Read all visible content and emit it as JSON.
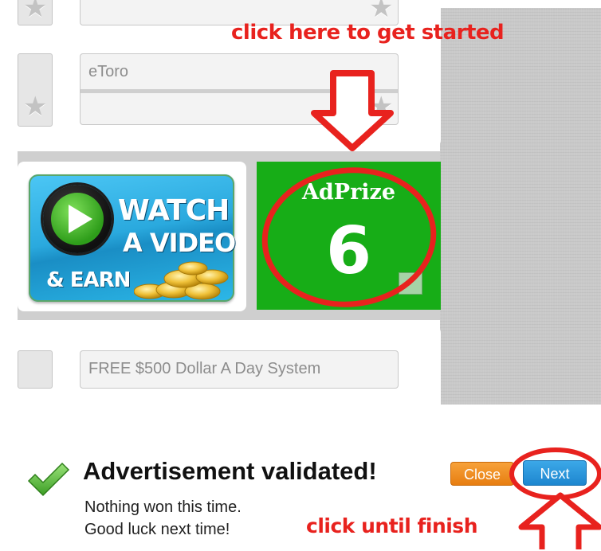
{
  "ad_list": {
    "item_2_label": "eToro",
    "item_3_label": "FREE $500 Dollar A Day System"
  },
  "watch_video_button": {
    "line1": "WATCH",
    "line2": "A VIDEO",
    "line3": "& EARN"
  },
  "adprize": {
    "title": "AdPrize",
    "count": "6"
  },
  "annotations": {
    "top": "click here to get started",
    "bottom": "click until finish"
  },
  "result": {
    "title": "Advertisement validated!",
    "line1": "Nothing won this time.",
    "line2": "Good luck next time!",
    "close_label": "Close",
    "next_label": "Next"
  },
  "colors": {
    "adprize_green": "#17ad17",
    "annotation_red": "#e8221e",
    "close_orange": "#f09022",
    "next_blue": "#2a96dc"
  }
}
